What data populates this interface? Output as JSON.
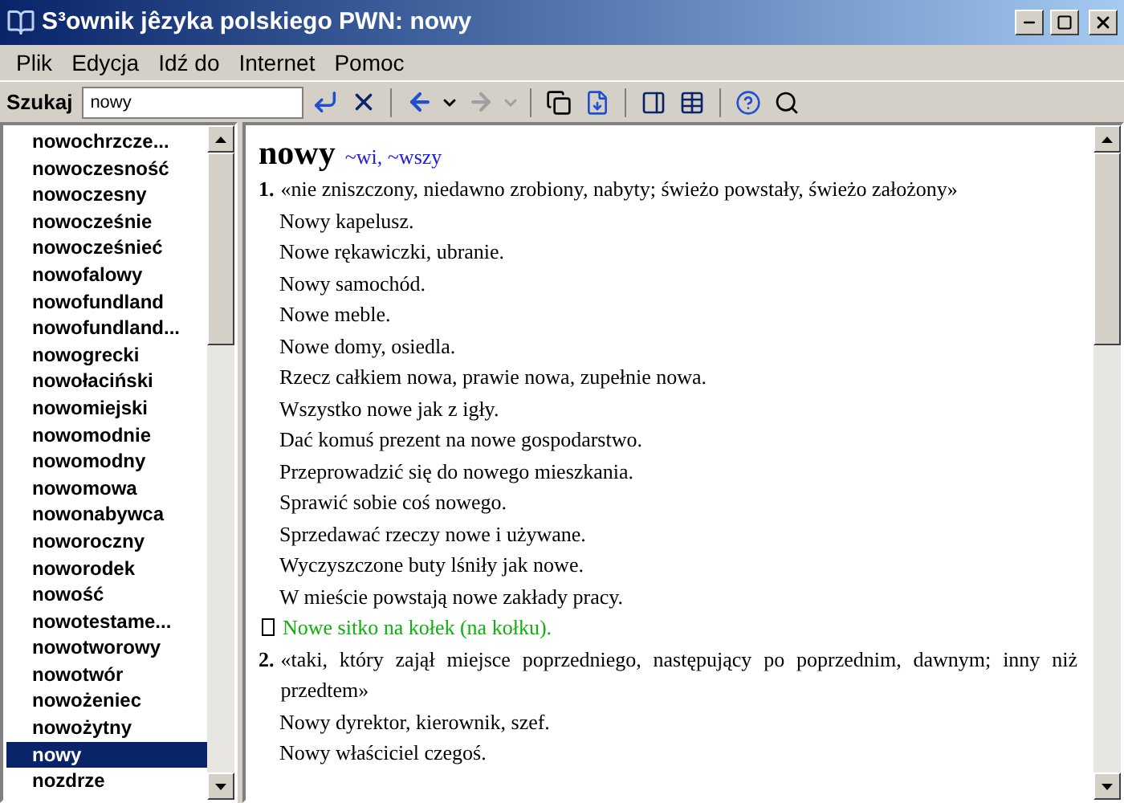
{
  "window": {
    "title": "S³ownik jêzyka polskiego PWN: nowy"
  },
  "menu": [
    "Plik",
    "Edycja",
    "Idź do",
    "Internet",
    "Pomoc"
  ],
  "toolbar": {
    "search_label": "Szukaj",
    "search_value": "nowy",
    "forward_disabled": true
  },
  "word_list": [
    {
      "text": "nowochrzcze...",
      "selected": false
    },
    {
      "text": "nowoczesność",
      "selected": false
    },
    {
      "text": "nowoczesny",
      "selected": false
    },
    {
      "text": "nowocześnie",
      "selected": false
    },
    {
      "text": "nowocześnieć",
      "selected": false
    },
    {
      "text": "nowofalowy",
      "selected": false
    },
    {
      "text": "nowofundland",
      "selected": false
    },
    {
      "text": "nowofundland...",
      "selected": false
    },
    {
      "text": "nowogrecki",
      "selected": false
    },
    {
      "text": "nowołaciński",
      "selected": false
    },
    {
      "text": "nowomiejski",
      "selected": false
    },
    {
      "text": "nowomodnie",
      "selected": false
    },
    {
      "text": "nowomodny",
      "selected": false
    },
    {
      "text": "nowomowa",
      "selected": false
    },
    {
      "text": "nowonabywca",
      "selected": false
    },
    {
      "text": "noworoczny",
      "selected": false
    },
    {
      "text": "noworodek",
      "selected": false
    },
    {
      "text": "nowość",
      "selected": false
    },
    {
      "text": "nowotestame...",
      "selected": false
    },
    {
      "text": "nowotworowy",
      "selected": false
    },
    {
      "text": "nowotwór",
      "selected": false
    },
    {
      "text": "nowożeniec",
      "selected": false
    },
    {
      "text": "nowożytny",
      "selected": false
    },
    {
      "text": "nowy",
      "selected": true
    },
    {
      "text": "nozdrze",
      "selected": false
    }
  ],
  "entry": {
    "headword": "nowy",
    "forms": "~wi, ~wszy",
    "senses": [
      {
        "number": "1.",
        "definition": "«nie zniszczony, niedawno zrobiony, nabyty; świeżo powstały, świeżo założony»",
        "examples": [
          "Nowy kapelusz.",
          "Nowe rękawiczki, ubranie.",
          "Nowy samochód.",
          "Nowe meble.",
          "Nowe domy, osiedla.",
          "Rzecz całkiem nowa, prawie nowa, zupełnie nowa.",
          "Wszystko nowe jak z igły.",
          "Dać komuś prezent na nowe gospodarstwo.",
          "Przeprowadzić się do nowego mieszkania.",
          "Sprawić sobie coś nowego.",
          "Sprzedawać rzeczy nowe i używane.",
          "Wyczyszczone buty lśniły jak nowe.",
          "W mieście powstają nowe zakłady pracy."
        ],
        "idiom": "Nowe sitko na kołek (na kołku)."
      },
      {
        "number": "2.",
        "definition": "«taki, który zajął miejsce poprzedniego, następujący po poprzednim, dawnym; inny niż przedtem»",
        "examples": [
          "Nowy dyrektor, kierownik, szef.",
          "Nowy właściciel czegoś."
        ]
      }
    ]
  }
}
